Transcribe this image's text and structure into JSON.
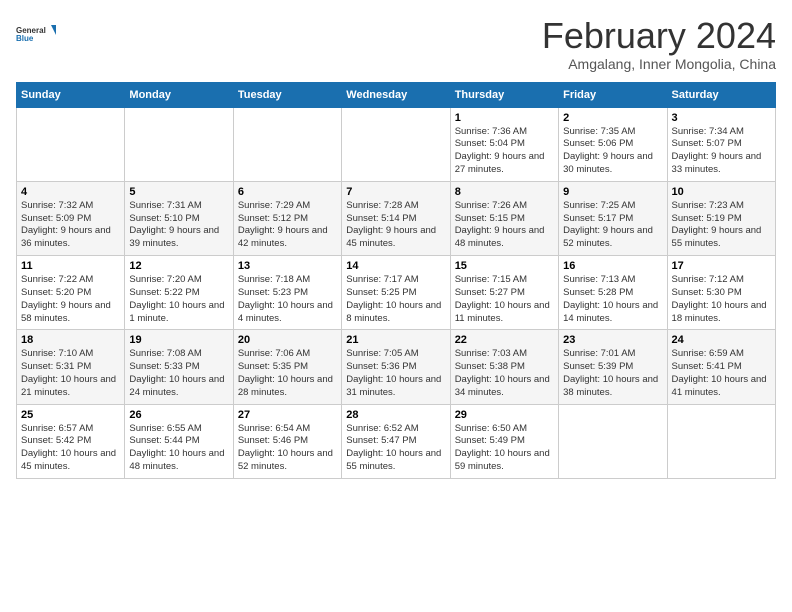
{
  "logo": {
    "text_general": "General",
    "text_blue": "Blue"
  },
  "title": "February 2024",
  "subtitle": "Amgalang, Inner Mongolia, China",
  "days_of_week": [
    "Sunday",
    "Monday",
    "Tuesday",
    "Wednesday",
    "Thursday",
    "Friday",
    "Saturday"
  ],
  "weeks": [
    [
      {
        "day": "",
        "sunrise": "",
        "sunset": "",
        "daylight": ""
      },
      {
        "day": "",
        "sunrise": "",
        "sunset": "",
        "daylight": ""
      },
      {
        "day": "",
        "sunrise": "",
        "sunset": "",
        "daylight": ""
      },
      {
        "day": "",
        "sunrise": "",
        "sunset": "",
        "daylight": ""
      },
      {
        "day": "1",
        "sunrise": "Sunrise: 7:36 AM",
        "sunset": "Sunset: 5:04 PM",
        "daylight": "Daylight: 9 hours and 27 minutes."
      },
      {
        "day": "2",
        "sunrise": "Sunrise: 7:35 AM",
        "sunset": "Sunset: 5:06 PM",
        "daylight": "Daylight: 9 hours and 30 minutes."
      },
      {
        "day": "3",
        "sunrise": "Sunrise: 7:34 AM",
        "sunset": "Sunset: 5:07 PM",
        "daylight": "Daylight: 9 hours and 33 minutes."
      }
    ],
    [
      {
        "day": "4",
        "sunrise": "Sunrise: 7:32 AM",
        "sunset": "Sunset: 5:09 PM",
        "daylight": "Daylight: 9 hours and 36 minutes."
      },
      {
        "day": "5",
        "sunrise": "Sunrise: 7:31 AM",
        "sunset": "Sunset: 5:10 PM",
        "daylight": "Daylight: 9 hours and 39 minutes."
      },
      {
        "day": "6",
        "sunrise": "Sunrise: 7:29 AM",
        "sunset": "Sunset: 5:12 PM",
        "daylight": "Daylight: 9 hours and 42 minutes."
      },
      {
        "day": "7",
        "sunrise": "Sunrise: 7:28 AM",
        "sunset": "Sunset: 5:14 PM",
        "daylight": "Daylight: 9 hours and 45 minutes."
      },
      {
        "day": "8",
        "sunrise": "Sunrise: 7:26 AM",
        "sunset": "Sunset: 5:15 PM",
        "daylight": "Daylight: 9 hours and 48 minutes."
      },
      {
        "day": "9",
        "sunrise": "Sunrise: 7:25 AM",
        "sunset": "Sunset: 5:17 PM",
        "daylight": "Daylight: 9 hours and 52 minutes."
      },
      {
        "day": "10",
        "sunrise": "Sunrise: 7:23 AM",
        "sunset": "Sunset: 5:19 PM",
        "daylight": "Daylight: 9 hours and 55 minutes."
      }
    ],
    [
      {
        "day": "11",
        "sunrise": "Sunrise: 7:22 AM",
        "sunset": "Sunset: 5:20 PM",
        "daylight": "Daylight: 9 hours and 58 minutes."
      },
      {
        "day": "12",
        "sunrise": "Sunrise: 7:20 AM",
        "sunset": "Sunset: 5:22 PM",
        "daylight": "Daylight: 10 hours and 1 minute."
      },
      {
        "day": "13",
        "sunrise": "Sunrise: 7:18 AM",
        "sunset": "Sunset: 5:23 PM",
        "daylight": "Daylight: 10 hours and 4 minutes."
      },
      {
        "day": "14",
        "sunrise": "Sunrise: 7:17 AM",
        "sunset": "Sunset: 5:25 PM",
        "daylight": "Daylight: 10 hours and 8 minutes."
      },
      {
        "day": "15",
        "sunrise": "Sunrise: 7:15 AM",
        "sunset": "Sunset: 5:27 PM",
        "daylight": "Daylight: 10 hours and 11 minutes."
      },
      {
        "day": "16",
        "sunrise": "Sunrise: 7:13 AM",
        "sunset": "Sunset: 5:28 PM",
        "daylight": "Daylight: 10 hours and 14 minutes."
      },
      {
        "day": "17",
        "sunrise": "Sunrise: 7:12 AM",
        "sunset": "Sunset: 5:30 PM",
        "daylight": "Daylight: 10 hours and 18 minutes."
      }
    ],
    [
      {
        "day": "18",
        "sunrise": "Sunrise: 7:10 AM",
        "sunset": "Sunset: 5:31 PM",
        "daylight": "Daylight: 10 hours and 21 minutes."
      },
      {
        "day": "19",
        "sunrise": "Sunrise: 7:08 AM",
        "sunset": "Sunset: 5:33 PM",
        "daylight": "Daylight: 10 hours and 24 minutes."
      },
      {
        "day": "20",
        "sunrise": "Sunrise: 7:06 AM",
        "sunset": "Sunset: 5:35 PM",
        "daylight": "Daylight: 10 hours and 28 minutes."
      },
      {
        "day": "21",
        "sunrise": "Sunrise: 7:05 AM",
        "sunset": "Sunset: 5:36 PM",
        "daylight": "Daylight: 10 hours and 31 minutes."
      },
      {
        "day": "22",
        "sunrise": "Sunrise: 7:03 AM",
        "sunset": "Sunset: 5:38 PM",
        "daylight": "Daylight: 10 hours and 34 minutes."
      },
      {
        "day": "23",
        "sunrise": "Sunrise: 7:01 AM",
        "sunset": "Sunset: 5:39 PM",
        "daylight": "Daylight: 10 hours and 38 minutes."
      },
      {
        "day": "24",
        "sunrise": "Sunrise: 6:59 AM",
        "sunset": "Sunset: 5:41 PM",
        "daylight": "Daylight: 10 hours and 41 minutes."
      }
    ],
    [
      {
        "day": "25",
        "sunrise": "Sunrise: 6:57 AM",
        "sunset": "Sunset: 5:42 PM",
        "daylight": "Daylight: 10 hours and 45 minutes."
      },
      {
        "day": "26",
        "sunrise": "Sunrise: 6:55 AM",
        "sunset": "Sunset: 5:44 PM",
        "daylight": "Daylight: 10 hours and 48 minutes."
      },
      {
        "day": "27",
        "sunrise": "Sunrise: 6:54 AM",
        "sunset": "Sunset: 5:46 PM",
        "daylight": "Daylight: 10 hours and 52 minutes."
      },
      {
        "day": "28",
        "sunrise": "Sunrise: 6:52 AM",
        "sunset": "Sunset: 5:47 PM",
        "daylight": "Daylight: 10 hours and 55 minutes."
      },
      {
        "day": "29",
        "sunrise": "Sunrise: 6:50 AM",
        "sunset": "Sunset: 5:49 PM",
        "daylight": "Daylight: 10 hours and 59 minutes."
      },
      {
        "day": "",
        "sunrise": "",
        "sunset": "",
        "daylight": ""
      },
      {
        "day": "",
        "sunrise": "",
        "sunset": "",
        "daylight": ""
      }
    ]
  ]
}
